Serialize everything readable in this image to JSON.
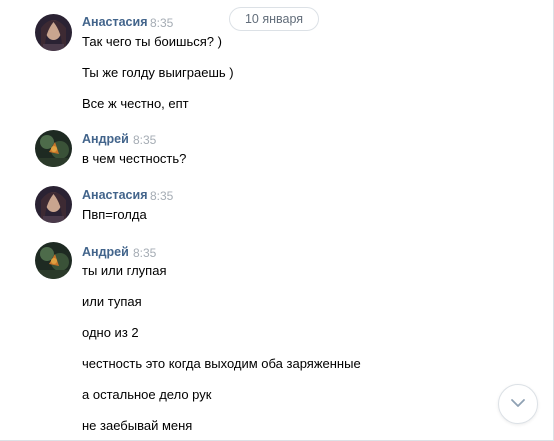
{
  "date_divider": "10 января",
  "groups": [
    {
      "author": "Анастасия",
      "time": "8:35",
      "avatar": "anastasia-avatar",
      "messages": [
        "Так чего ты боишься? )",
        "Ты же голду выиграешь )",
        "Все ж честно, епт"
      ]
    },
    {
      "author": "Андрей",
      "time": "8:35",
      "avatar": "andrey-avatar",
      "messages": [
        "в чем честность?"
      ]
    },
    {
      "author": "Анастасия",
      "time": "8:35",
      "avatar": "anastasia-avatar",
      "messages": [
        "Пвп=голда"
      ]
    },
    {
      "author": "Андрей",
      "time": "8:35",
      "avatar": "andrey-avatar",
      "messages": [
        "ты или глупая",
        "или тупая",
        "одно из 2",
        "честность это когда выходим оба заряженные",
        "а остальное дело рук",
        "не заебывай меня"
      ]
    }
  ],
  "scroll_button": {
    "icon": "chevron-down-icon"
  },
  "colors": {
    "author": "#42648b",
    "time": "#a5acb4",
    "divider_text": "#626d7a",
    "border": "#dce1e6"
  }
}
